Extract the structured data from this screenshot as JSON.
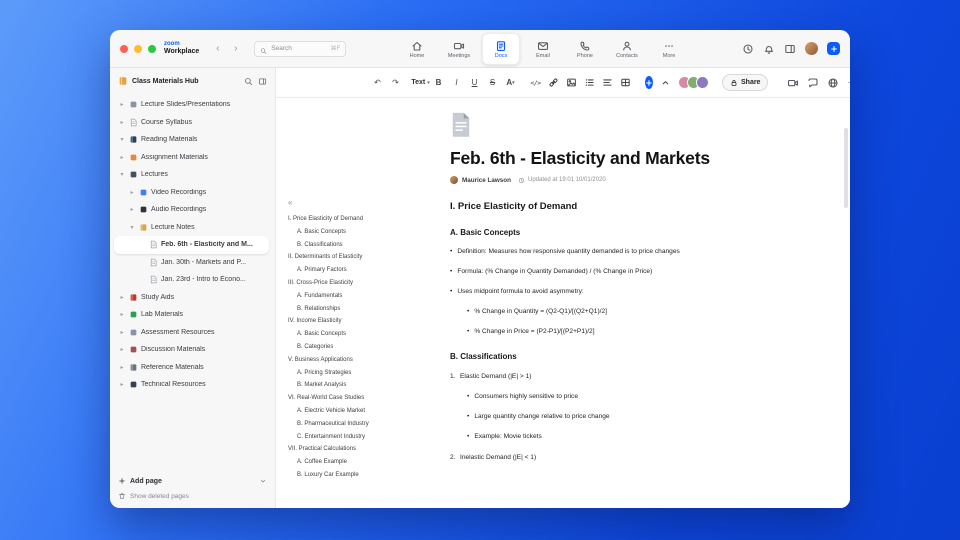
{
  "colors": {
    "accent": "#0b5cff",
    "background_gradient_start": "#5d9bfa",
    "background_gradient_end": "#0a3fd0",
    "selected_row_bg": "#ffffff"
  },
  "titlebar": {
    "logo_top": "zoom",
    "logo_bottom": "Workplace",
    "search": {
      "placeholder": "Search",
      "shortcut": "⌘F"
    },
    "tabs": [
      {
        "label": "Home",
        "icon": "home",
        "active": false
      },
      {
        "label": "Meetings",
        "icon": "meetings",
        "active": false
      },
      {
        "label": "Docs",
        "icon": "docs",
        "active": true
      },
      {
        "label": "Email",
        "icon": "email",
        "active": false
      },
      {
        "label": "Phone",
        "icon": "phone",
        "active": false
      },
      {
        "label": "Contacts",
        "icon": "contacts",
        "active": false
      },
      {
        "label": "More",
        "icon": "more",
        "active": false
      }
    ]
  },
  "sidebar": {
    "title": "Class Materials Hub",
    "tree": [
      {
        "label": "Lecture Slides/Presentations",
        "level": 0,
        "chevron": "right",
        "icon": "square",
        "color": "#8a93a6",
        "selected": false
      },
      {
        "label": "Course Syllabus",
        "level": 0,
        "chevron": "right",
        "icon": "page",
        "color": "#9aa0aa",
        "selected": false
      },
      {
        "label": "Reading Materials",
        "level": 0,
        "chevron": "down",
        "icon": "book",
        "color": "#274060",
        "selected": false
      },
      {
        "label": "Assignment Materials",
        "level": 0,
        "chevron": "right",
        "icon": "square",
        "color": "#e8883a",
        "selected": false
      },
      {
        "label": "Lectures",
        "level": 0,
        "chevron": "down",
        "icon": "square",
        "color": "#4a4f58",
        "selected": false
      },
      {
        "label": "Video Recordings",
        "level": 1,
        "chevron": "right",
        "icon": "square",
        "color": "#3b82f6",
        "selected": false
      },
      {
        "label": "Audio Recordings",
        "level": 1,
        "chevron": "right",
        "icon": "square",
        "color": "#2f3340",
        "selected": false
      },
      {
        "label": "Lecture Notes",
        "level": 1,
        "chevron": "down",
        "icon": "book",
        "color": "#d9a441",
        "selected": false
      },
      {
        "label": "Feb. 6th - Elasticity and M...",
        "level": 2,
        "chevron": "none",
        "icon": "page",
        "color": "#9aa0aa",
        "selected": true
      },
      {
        "label": "Jan. 30th - Markets and P...",
        "level": 2,
        "chevron": "none",
        "icon": "page",
        "color": "#9aa0aa",
        "selected": false
      },
      {
        "label": "Jan. 23rd - Intro to Econo...",
        "level": 2,
        "chevron": "none",
        "icon": "page",
        "color": "#9aa0aa",
        "selected": false
      },
      {
        "label": "Study Aids",
        "level": 0,
        "chevron": "right",
        "icon": "book",
        "color": "#c0392b",
        "selected": false
      },
      {
        "label": "Lab Materials",
        "level": 0,
        "chevron": "right",
        "icon": "square",
        "color": "#2e9e5b",
        "selected": false
      },
      {
        "label": "Assessment Resources",
        "level": 0,
        "chevron": "right",
        "icon": "square",
        "color": "#8a93a6",
        "selected": false
      },
      {
        "label": "Discussion Materials",
        "level": 0,
        "chevron": "right",
        "icon": "square",
        "color": "#a05252",
        "selected": false
      },
      {
        "label": "Reference Materials",
        "level": 0,
        "chevron": "right",
        "icon": "book",
        "color": "#6b7280",
        "selected": false
      },
      {
        "label": "Technical Resources",
        "level": 0,
        "chevron": "right",
        "icon": "square",
        "color": "#374151",
        "selected": false
      }
    ],
    "add_page_label": "Add page",
    "show_deleted_label": "Show deleted pages"
  },
  "toolbar": {
    "text_style": "Text",
    "bold": "B",
    "italic": "I",
    "underline": "U",
    "strikethrough": "S",
    "text_color": "A",
    "code": "</>",
    "share_label": "Share",
    "more": "⋯",
    "avatars": [
      "#d98aa3",
      "#7fae6e",
      "#8d79c0"
    ]
  },
  "document": {
    "title": "Feb. 6th - Elasticity and Markets",
    "author": "Maurice Lawson",
    "updated": "Updated at 19:01 10/01/2020",
    "outline": [
      {
        "text": "I. Price Elasticity of Demand",
        "level": 0
      },
      {
        "text": "A. Basic Concepts",
        "level": 1
      },
      {
        "text": "B. Classifications",
        "level": 1
      },
      {
        "text": "II. Determinants of Elasticity",
        "level": 0
      },
      {
        "text": "A. Primary Factors",
        "level": 1
      },
      {
        "text": "III. Cross-Price Elasticity",
        "level": 0
      },
      {
        "text": "A. Fundamentals",
        "level": 1
      },
      {
        "text": "B. Relationships",
        "level": 1
      },
      {
        "text": "IV. Income Elasticity",
        "level": 0
      },
      {
        "text": "A. Basic Concepts",
        "level": 1
      },
      {
        "text": "B. Categories",
        "level": 1
      },
      {
        "text": "V. Business Applications",
        "level": 0
      },
      {
        "text": "A. Pricing Strategies",
        "level": 1
      },
      {
        "text": "B. Market Analysis",
        "level": 1
      },
      {
        "text": "VI. Real-World Case Studies",
        "level": 0
      },
      {
        "text": "A. Electric Vehicle Market",
        "level": 1
      },
      {
        "text": "B. Pharmaceutical Industry",
        "level": 1
      },
      {
        "text": "C. Entertainment Industry",
        "level": 1
      },
      {
        "text": "VII. Practical Calculations",
        "level": 0
      },
      {
        "text": "A. Coffee Example",
        "level": 1
      },
      {
        "text": "B. Luxury Car Example",
        "level": 1
      }
    ],
    "blocks": [
      {
        "type": "h2",
        "text": "I. Price Elasticity of Demand"
      },
      {
        "type": "h3",
        "text": "A. Basic Concepts"
      },
      {
        "type": "li",
        "text": "Definition: Measures how responsive quantity demanded is to price changes"
      },
      {
        "type": "li",
        "text": "Formula: (% Change in Quantity Demanded) / (% Change in Price)"
      },
      {
        "type": "li",
        "text": "Uses midpoint formula to avoid asymmetry:"
      },
      {
        "type": "li2",
        "text": "% Change in Quantity = (Q2-Q1)/[(Q2+Q1)/2]"
      },
      {
        "type": "li2",
        "text": "% Change in Price = (P2-P1)/[(P2+P1)/2]"
      },
      {
        "type": "h3",
        "text": "B. Classifications"
      },
      {
        "type": "num",
        "n": "1.",
        "text": "Elastic Demand (|E| > 1)"
      },
      {
        "type": "li2",
        "text": "Consumers highly sensitive to price"
      },
      {
        "type": "li2",
        "text": "Large quantity change relative to price change"
      },
      {
        "type": "li2",
        "text": "Example: Movie tickets"
      },
      {
        "type": "num",
        "n": "2.",
        "text": "Inelastic Demand (|E| < 1)"
      }
    ]
  }
}
